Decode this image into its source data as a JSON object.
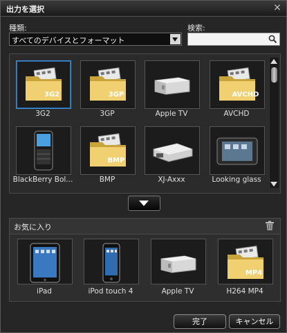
{
  "window": {
    "title": "出力を選択",
    "close_glyph": "×"
  },
  "filter": {
    "label": "種類:",
    "selected": "すべてのデバイスとフォーマット"
  },
  "search": {
    "label": "検索:",
    "placeholder": "",
    "value": ""
  },
  "formats": [
    {
      "label": "3G2",
      "icon": "folder-3g2-icon",
      "badge": "3G2",
      "selected": true
    },
    {
      "label": "3GP",
      "icon": "folder-3gp-icon",
      "badge": "3GP"
    },
    {
      "label": "Apple TV",
      "icon": "apple-tv-icon"
    },
    {
      "label": "AVCHD",
      "icon": "folder-avchd-icon",
      "badge": "AVCHD"
    },
    {
      "label": "BlackBerry Bol...",
      "icon": "blackberry-phone-icon"
    },
    {
      "label": "BMP",
      "icon": "folder-bmp-icon",
      "badge": "BMP"
    },
    {
      "label": "XJ-Axxx",
      "icon": "projector-icon"
    },
    {
      "label": "Looking glass",
      "icon": "tablet-icon"
    }
  ],
  "favorites": {
    "title": "お気に入り",
    "items": [
      {
        "label": "iPad",
        "icon": "ipad-icon"
      },
      {
        "label": "iPod touch 4",
        "icon": "ipod-touch-icon"
      },
      {
        "label": "Apple TV",
        "icon": "apple-tv-icon"
      },
      {
        "label": "H264 MP4",
        "icon": "folder-mp4-icon",
        "badge": "MP4"
      }
    ]
  },
  "buttons": {
    "ok": "完了",
    "cancel": "キャンセル"
  }
}
